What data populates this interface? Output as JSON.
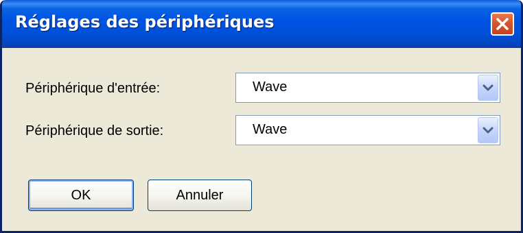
{
  "window": {
    "title": "Réglages des périphériques",
    "close_icon": "close-icon"
  },
  "form": {
    "input_label": "Périphérique d'entrée:",
    "input_value": "Wave",
    "output_label": "Périphérique de sortie:",
    "output_value": "Wave",
    "dropdown_icon": "chevron-down-icon"
  },
  "buttons": {
    "ok_label": "OK",
    "cancel_label": "Annuler"
  },
  "colors": {
    "titlebar": "#0054e3",
    "dialog_background": "#ece9d8",
    "close_button": "#d7552c",
    "field_border": "#7f9db9",
    "dropdown_arrow": "#4d6185"
  }
}
